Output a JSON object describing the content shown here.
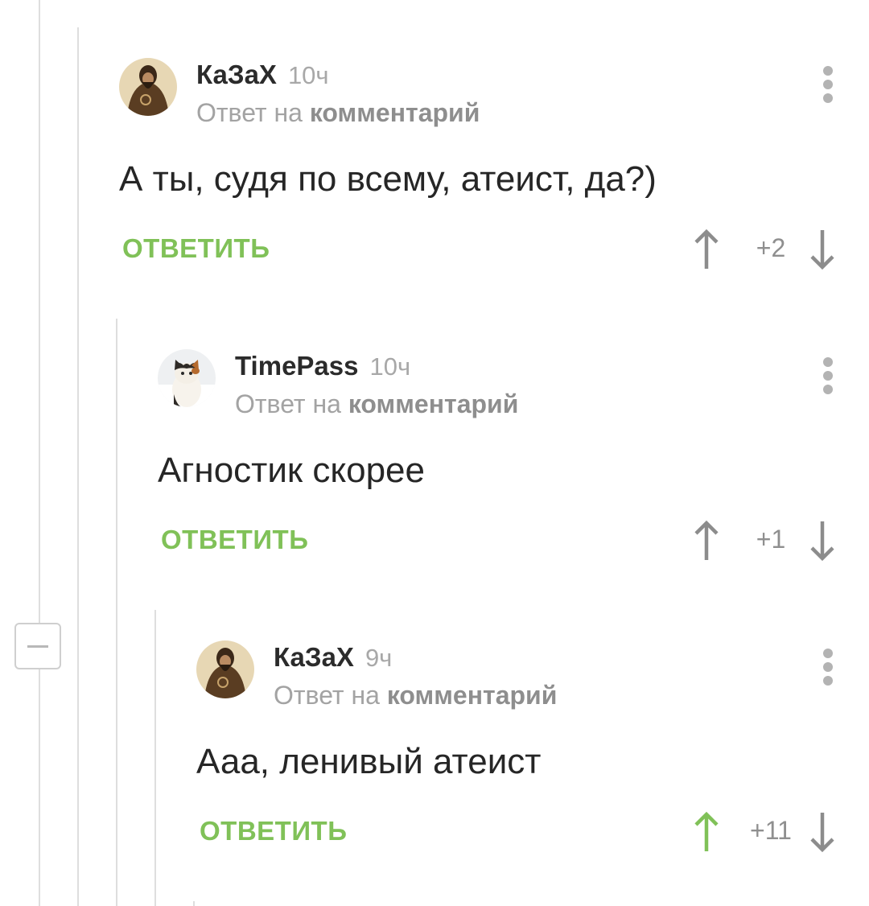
{
  "comments": [
    {
      "author": "КаЗаХ",
      "time": "10ч",
      "reply_prefix": "Ответ на",
      "reply_target": "комментарий",
      "text": "А ты, судя по всему, атеист, да?)",
      "reply_label": "ОТВЕТИТЬ",
      "score": "+2",
      "upvoted": false
    },
    {
      "author": "TimePass",
      "time": "10ч",
      "reply_prefix": "Ответ на",
      "reply_target": "комментарий",
      "text": "Агностик скорее",
      "reply_label": "ОТВЕТИТЬ",
      "score": "+1",
      "upvoted": false
    },
    {
      "author": "КаЗаХ",
      "time": "9ч",
      "reply_prefix": "Ответ на",
      "reply_target": "комментарий",
      "text": "Ааа, ленивый атеист",
      "reply_label": "ОТВЕТИТЬ",
      "score": "+11",
      "upvoted": true
    }
  ],
  "colors": {
    "accent_green": "#80c158",
    "arrow_gray": "#8c8c8c",
    "thread_line": "#dedede"
  },
  "icons": {
    "upvote": "arrow-up-icon",
    "downvote": "arrow-down-icon",
    "more": "vertical-dots-icon",
    "collapse": "minus-icon"
  }
}
